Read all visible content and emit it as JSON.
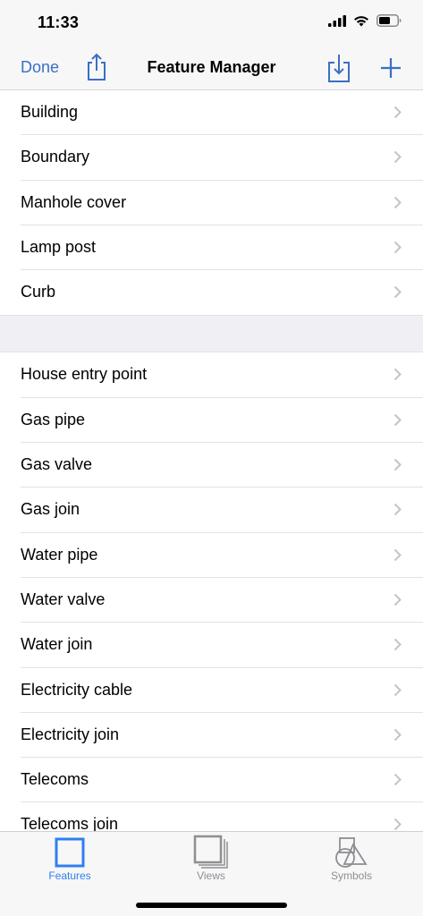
{
  "status": {
    "time": "11:33"
  },
  "nav": {
    "done_label": "Done",
    "title": "Feature Manager",
    "icons": [
      "share-icon",
      "import-icon",
      "plus-icon"
    ],
    "accent_color": "#3a6fc4"
  },
  "sections": [
    {
      "items": [
        "Building",
        "Boundary",
        "Manhole cover",
        "Lamp post",
        "Curb"
      ]
    },
    {
      "items": [
        "House entry point",
        "Gas pipe",
        "Gas valve",
        "Gas join",
        "Water pipe",
        "Water valve",
        "Water join",
        "Electricity cable",
        "Electricity join",
        "Telecoms",
        "Telecoms join"
      ]
    }
  ],
  "tabs": [
    {
      "label": "Features",
      "icon": "square-icon",
      "selected": true
    },
    {
      "label": "Views",
      "icon": "stacked-squares-icon",
      "selected": false
    },
    {
      "label": "Symbols",
      "icon": "shapes-icon",
      "selected": false
    }
  ],
  "colors": {
    "selected_tab": "#2f7ff0",
    "unselected_tab": "#8e8e93"
  }
}
